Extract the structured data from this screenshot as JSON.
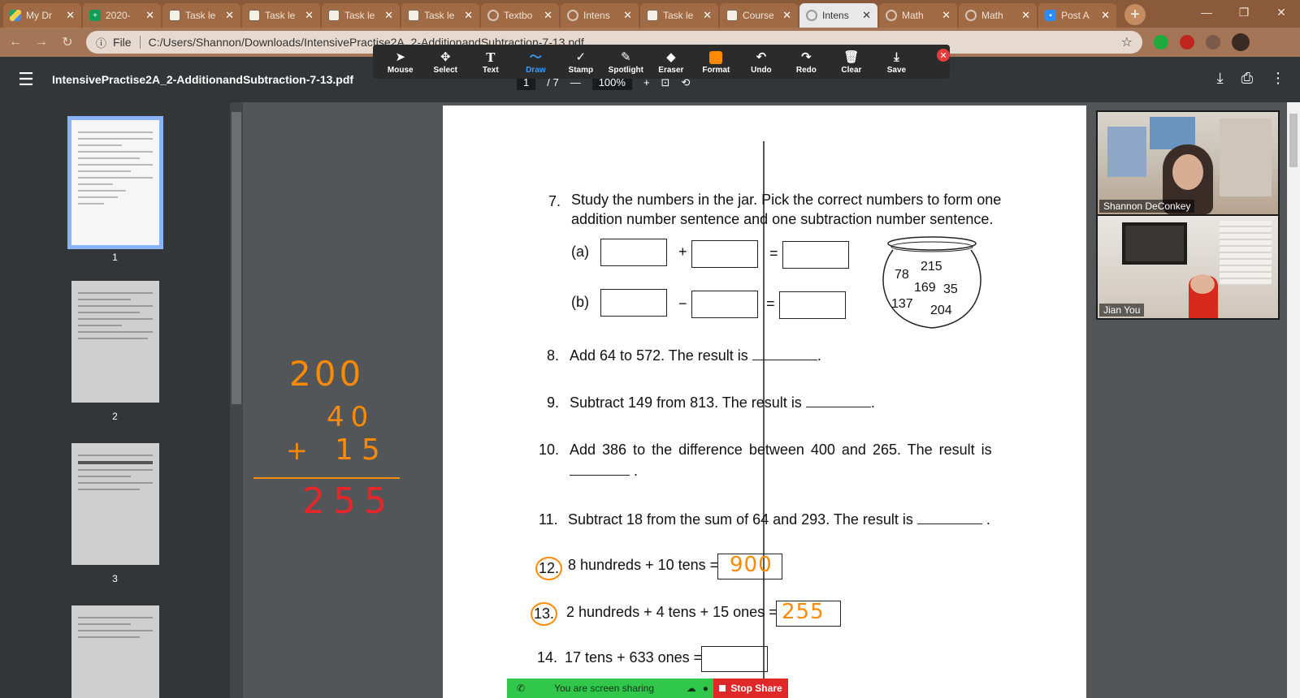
{
  "browser": {
    "tabs": [
      {
        "label": "My Dr",
        "icon": "drive-icon"
      },
      {
        "label": "2020-",
        "icon": "sheets-icon"
      },
      {
        "label": "Task le",
        "icon": "task-icon"
      },
      {
        "label": "Task le",
        "icon": "task-icon"
      },
      {
        "label": "Task le",
        "icon": "task-icon"
      },
      {
        "label": "Task le",
        "icon": "task-icon"
      },
      {
        "label": "Textbo",
        "icon": "globe-icon"
      },
      {
        "label": "Intens",
        "icon": "globe-icon"
      },
      {
        "label": "Task le",
        "icon": "task-icon"
      },
      {
        "label": "Course",
        "icon": "task-icon"
      },
      {
        "label": "Intens",
        "icon": "globe-icon",
        "active": true
      },
      {
        "label": "Math",
        "icon": "globe-icon"
      },
      {
        "label": "Math",
        "icon": "globe-icon"
      },
      {
        "label": "Post A",
        "icon": "zoom-icon"
      }
    ],
    "address": {
      "scheme_label": "File",
      "url": "C:/Users/Shannon/Downloads/IntensivePractise2A_2-AdditionandSubtraction-7-13.pdf"
    }
  },
  "pdf": {
    "title": "IntensivePractise2A_2-AdditionandSubtraction-7-13.pdf",
    "page_current": "1",
    "page_total": "/ 7",
    "zoom": "100%",
    "thumbnails": [
      "1",
      "2",
      "3"
    ]
  },
  "annotate_toolbar": {
    "tools": [
      "Mouse",
      "Select",
      "Text",
      "Draw",
      "Stamp",
      "Spotlight",
      "Eraser",
      "Format",
      "Undo",
      "Redo",
      "Clear",
      "Save"
    ],
    "accent_color": "#3c9bff",
    "format_color": "#ff8a00"
  },
  "worksheet": {
    "q7_num": "7.",
    "q7_line1": "Study the numbers in the jar. Pick the correct numbers to form one",
    "q7_line2": "addition number sentence and one subtraction number sentence.",
    "q7a_label": "(a)",
    "q7b_label": "(b)",
    "plus": "+",
    "minus": "−",
    "equals": "=",
    "jar_numbers": [
      "215",
      "78",
      "169",
      "35",
      "137",
      "204"
    ],
    "q8_num": "8.",
    "q8_text": "Add 64 to 572. The result is",
    "q9_num": "9.",
    "q9_text": "Subtract 149 from 813. The result is",
    "q10_num": "10.",
    "q10_text": "Add 386 to the difference between 400 and 265. The result is",
    "q11_num": "11.",
    "q11_text": "Subtract 18 from the sum of 64 and 293. The result is",
    "q12_num": "12.",
    "q12_text": "8 hundreds + 10 tens =",
    "q12_answer": "900",
    "q13_num": "13.",
    "q13_text": "2 hundreds + 4 tens + 15 ones =",
    "q13_answer": "255",
    "q14_num": "14.",
    "q14_text": "17 tens + 633 ones ="
  },
  "handwriting": {
    "addend1": "200",
    "addend2": "40",
    "plus": "+",
    "addend3": "15",
    "sum": "255",
    "colors": {
      "orange": "#ff8a00",
      "red": "#e8262a"
    }
  },
  "zoom": {
    "participants": [
      "Shannon DeConkey",
      "Jian You"
    ],
    "share_status": "You are screen sharing",
    "stop_label": "Stop Share"
  }
}
